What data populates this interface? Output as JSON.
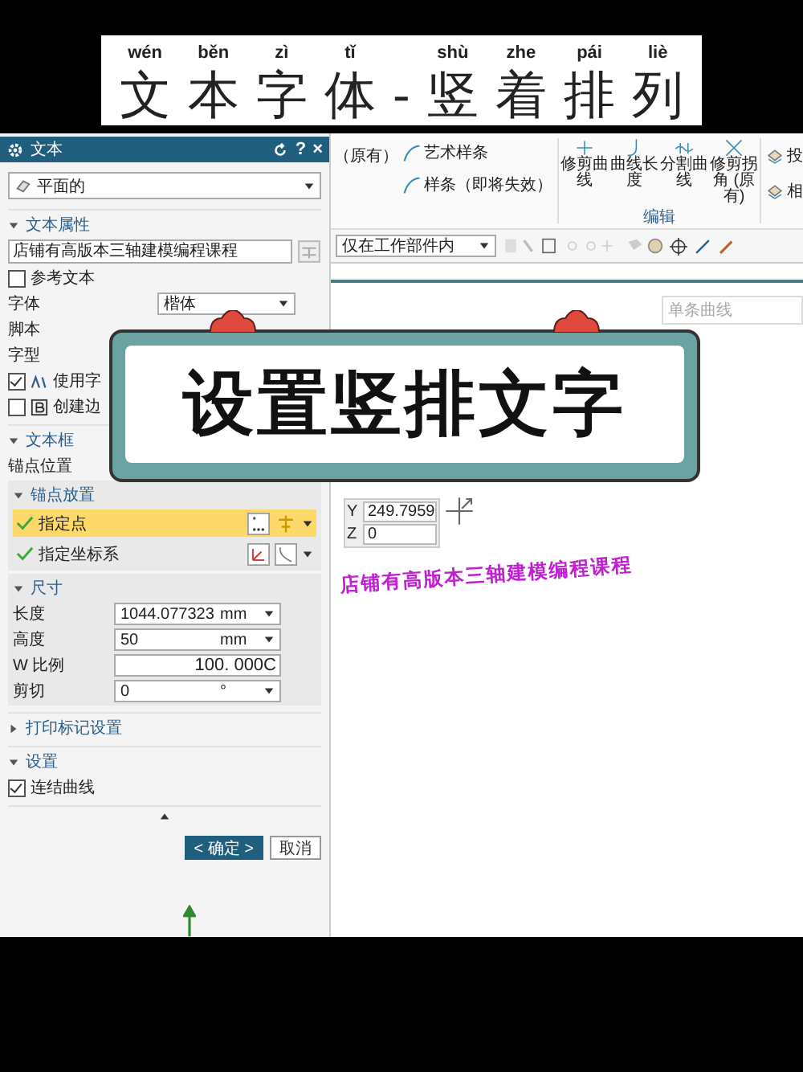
{
  "banner": {
    "chars": [
      {
        "pinyin": "wén",
        "char": "文"
      },
      {
        "pinyin": "běn",
        "char": "本"
      },
      {
        "pinyin": "zì",
        "char": "字"
      },
      {
        "pinyin": "tǐ",
        "char": "体"
      },
      {
        "char": "-"
      },
      {
        "pinyin": "shù",
        "char": "竖"
      },
      {
        "pinyin": "zhe",
        "char": "着"
      },
      {
        "pinyin": "pái",
        "char": "排"
      },
      {
        "pinyin": "liè",
        "char": "列"
      }
    ]
  },
  "sticker": {
    "text": "设置竖排文字"
  },
  "ribbon": {
    "left_label": "（原有）",
    "splines": [
      "艺术样条",
      "样条（即将失效）"
    ],
    "edit_tools": [
      "修剪曲线",
      "曲线长度",
      "分割曲线",
      "修剪拐角 (原有)"
    ],
    "edit_group": "编辑",
    "right_tools": [
      "投",
      "相"
    ]
  },
  "toolbar": {
    "filter": "仅在工作部件内"
  },
  "canvas": {
    "selection_field": "单条曲线",
    "coords": [
      {
        "axis": "Y",
        "value": "249.7959"
      },
      {
        "axis": "Z",
        "value": "0"
      }
    ],
    "model_text": "店铺有高版本三轴建模编程课程"
  },
  "dialog": {
    "title": "文本",
    "header_buttons": [
      "?",
      "×"
    ],
    "mode": "平面的",
    "text_props": {
      "title": "文本属性",
      "expanded": true,
      "value": "店铺有高版本三轴建模编程课程",
      "reference": {
        "label": "参考文本",
        "checked": false
      },
      "rows": [
        {
          "label": "字体",
          "value": "楷体"
        },
        {
          "label": "脚本"
        },
        {
          "label": "字型"
        }
      ],
      "checks": [
        {
          "label": "使用字",
          "checked": true
        },
        {
          "label": "创建边",
          "checked": false
        }
      ]
    },
    "frame": {
      "title": "文本框",
      "expanded": true,
      "anchor_label": "锚点位置",
      "placement": {
        "title": "锚点放置",
        "expanded": true,
        "items": [
          {
            "label": "指定点",
            "selected": true
          },
          {
            "label": "指定坐标系",
            "selected": false
          }
        ]
      },
      "size": {
        "title": "尺寸",
        "expanded": true,
        "fields": [
          {
            "label": "长度",
            "value": "1044.077323",
            "unit": "mm",
            "kind": "dropdown"
          },
          {
            "label": "高度",
            "value": "50",
            "unit": "mm",
            "kind": "dropdown"
          },
          {
            "label": "W 比例",
            "value": "100. 000C",
            "kind": "plain"
          },
          {
            "label": "剪切",
            "value": "0",
            "unit": "°",
            "kind": "dropdown"
          }
        ]
      }
    },
    "print": {
      "title": "打印标记设置",
      "expanded": false
    },
    "settings": {
      "title": "设置",
      "expanded": true,
      "items": [
        {
          "label": "连结曲线",
          "checked": true
        }
      ]
    },
    "buttons": [
      {
        "label": "< 确定 >",
        "kind": "primary"
      },
      {
        "label": "取消",
        "kind": "secondary"
      }
    ]
  }
}
